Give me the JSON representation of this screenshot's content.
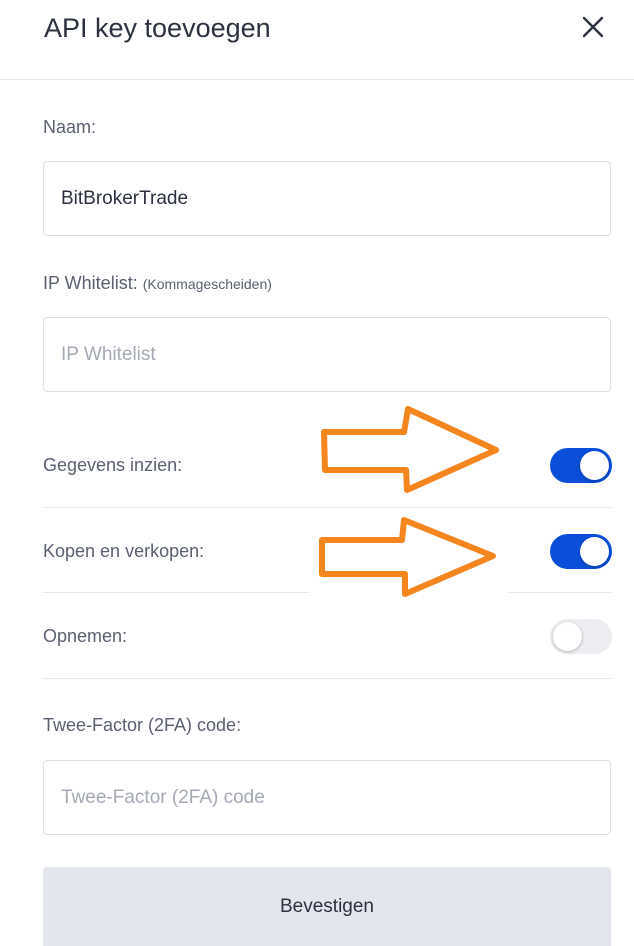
{
  "dialog": {
    "title": "API key toevoegen",
    "close_icon": "close-icon"
  },
  "form": {
    "name": {
      "label": "Naam:",
      "value": "BitBrokerTrade"
    },
    "ip_whitelist": {
      "label": "IP Whitelist:",
      "hint": "(Kommagescheiden)",
      "placeholder": "IP Whitelist"
    },
    "permissions": [
      {
        "label": "Gegevens inzien:",
        "enabled": true
      },
      {
        "label": "Kopen en verkopen:",
        "enabled": true
      },
      {
        "label": "Opnemen:",
        "enabled": false
      }
    ],
    "two_factor": {
      "label": "Twee-Factor (2FA) code:",
      "placeholder": "Twee-Factor (2FA) code"
    },
    "submit_label": "Bevestigen"
  },
  "annotations": {
    "arrow_color": "#f5861f",
    "arrow_icon": "arrow-right-icon"
  },
  "colors": {
    "toggle_on": "#0a4ed9",
    "toggle_off": "#eceef2",
    "button_bg": "#e3e6ec"
  }
}
